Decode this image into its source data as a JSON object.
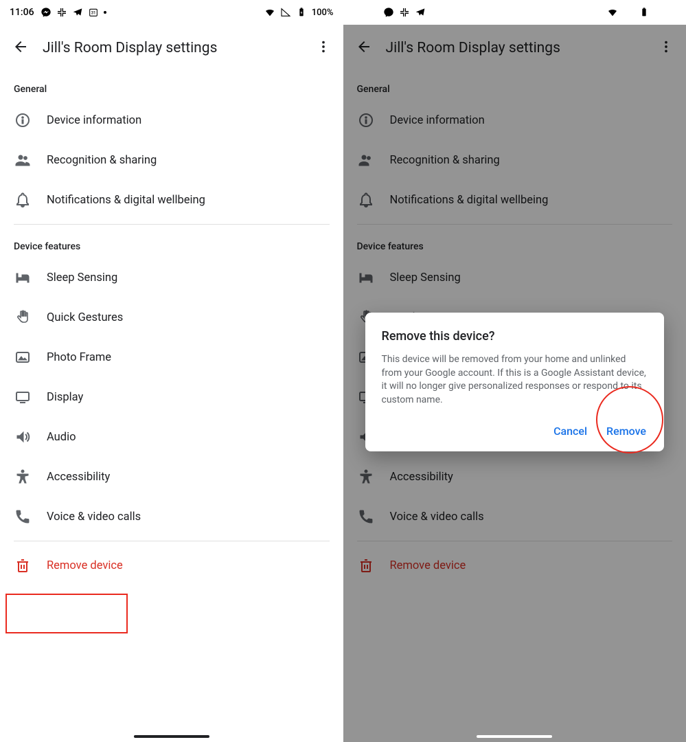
{
  "status": {
    "time": "11:06",
    "battery": "100%"
  },
  "appbar": {
    "title": "Jill's Room Display settings"
  },
  "sections": {
    "general": {
      "header": "General",
      "items": [
        {
          "label": "Device information"
        },
        {
          "label": "Recognition & sharing"
        },
        {
          "label": "Notifications & digital wellbeing"
        }
      ]
    },
    "features": {
      "header": "Device features",
      "items": [
        {
          "label": "Sleep Sensing"
        },
        {
          "label": "Quick Gestures"
        },
        {
          "label": "Photo Frame"
        },
        {
          "label": "Display"
        },
        {
          "label": "Audio"
        },
        {
          "label": "Accessibility"
        },
        {
          "label": "Voice & video calls"
        }
      ]
    },
    "remove": {
      "label": "Remove device"
    }
  },
  "dialog": {
    "title": "Remove this device?",
    "body": "This device will be removed from your home and unlinked from your Google account. If this is a Google Assistant device, it will no longer give personalized responses or respond to its custom name.",
    "cancel": "Cancel",
    "confirm": "Remove"
  }
}
